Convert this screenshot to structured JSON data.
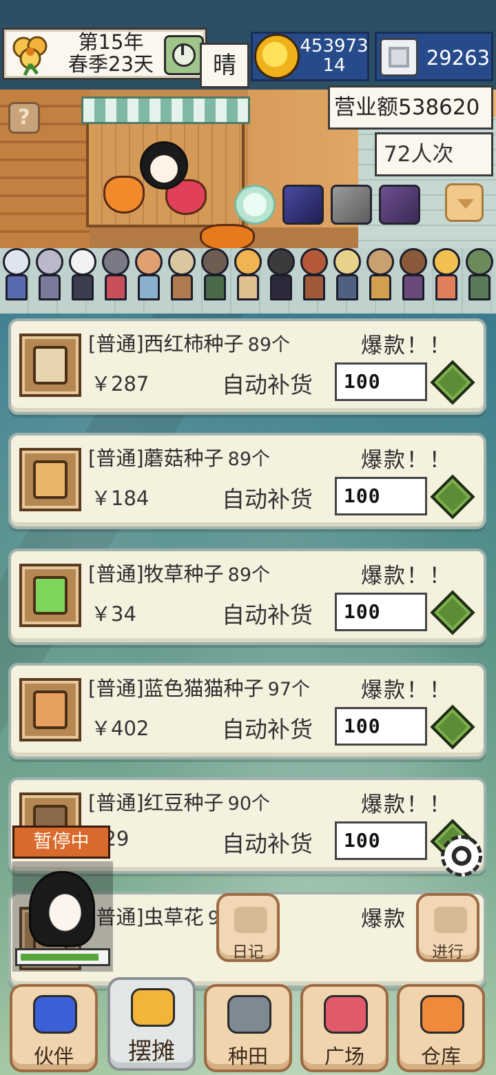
{
  "hud": {
    "year": "第15年",
    "season_day": "春季23天",
    "weather": "晴",
    "gold_line1": "453973",
    "gold_line2": "14",
    "gems": "29263",
    "sales": "营业额538620",
    "visitors": "72人次",
    "help": "?"
  },
  "products": [
    {
      "name": "[普通]西红柿种子",
      "qty": "89个",
      "hot": "爆款！！",
      "price": "￥287",
      "restock": "自动补货",
      "amount": "100",
      "icon": "tomato-seed-icon",
      "color": "#e7d5b0"
    },
    {
      "name": "[普通]蘑菇种子",
      "qty": "89个",
      "hot": "爆款！！",
      "price": "￥184",
      "restock": "自动补货",
      "amount": "100",
      "icon": "mushroom-seed-icon",
      "color": "#e8b56a"
    },
    {
      "name": "[普通]牧草种子",
      "qty": "89个",
      "hot": "爆款！！",
      "price": "￥34",
      "restock": "自动补货",
      "amount": "100",
      "icon": "grass-seed-icon",
      "color": "#7bd65a"
    },
    {
      "name": "[普通]蓝色猫猫种子",
      "qty": "97个",
      "hot": "爆款！！",
      "price": "￥402",
      "restock": "自动补货",
      "amount": "100",
      "icon": "blue-cat-seed-icon",
      "color": "#e8a060"
    },
    {
      "name": "[普通]红豆种子",
      "qty": "90个",
      "hot": "爆款！！",
      "price": "229",
      "restock": "自动补货",
      "amount": "100",
      "icon": "red-bean-seed-icon",
      "color": "#8a6a4a"
    },
    {
      "name": "[普通]虫草花",
      "qty": "95个",
      "hot": "爆款",
      "price": "",
      "restock": "",
      "amount": "",
      "icon": "cordyceps-seed-icon",
      "color": "#cfa274"
    }
  ],
  "overlay": {
    "paused": "暂停中",
    "hp_fraction": 0.88,
    "diary": "日记",
    "proceed": "进行"
  },
  "nav": [
    {
      "label": "伙伴",
      "icon": "partners-icon",
      "color": "#3b5fd6"
    },
    {
      "label": "摆摊",
      "icon": "stall-coins-icon",
      "color": "#f2b53a",
      "active": true
    },
    {
      "label": "种田",
      "icon": "watering-can-icon",
      "color": "#7d8a93"
    },
    {
      "label": "广场",
      "icon": "flower-plaza-icon",
      "color": "#e05a6a"
    },
    {
      "label": "仓库",
      "icon": "warehouse-house-icon",
      "color": "#f08a3a"
    }
  ]
}
